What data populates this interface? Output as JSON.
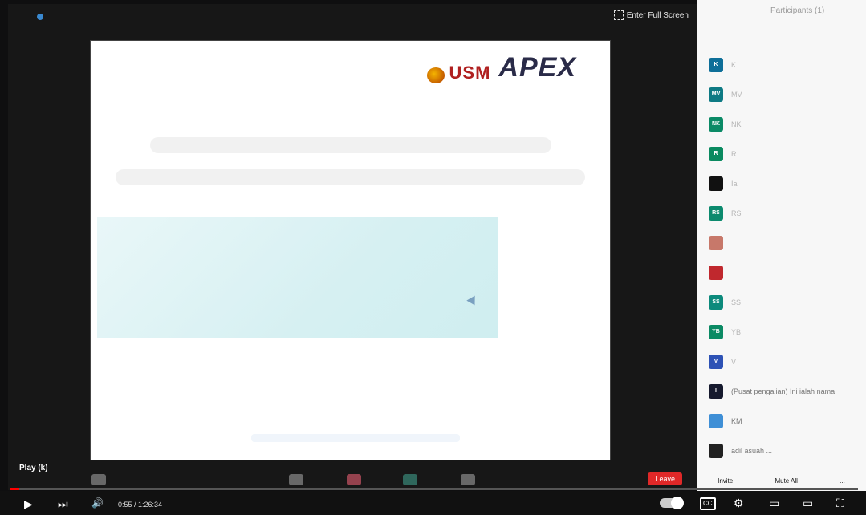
{
  "meeting": {
    "fullscreen_label": "Enter Full Screen",
    "slide": {
      "usm_logo_text": "USM",
      "apex_logo_text": "APEX"
    },
    "toolbar": {
      "leave_label": "Leave"
    }
  },
  "participants_panel": {
    "title": "Participants (1)",
    "participants": [
      {
        "initials": "K",
        "name": "K",
        "color": "#0e6f99"
      },
      {
        "initials": "MV",
        "name": "MV",
        "color": "#0e7a84"
      },
      {
        "initials": "NK",
        "name": "NK",
        "color": "#0b8a66"
      },
      {
        "initials": "R",
        "name": "R",
        "color": "#0a8a60"
      },
      {
        "initials": "",
        "name": "Ia",
        "color": "#111111"
      },
      {
        "initials": "RS",
        "name": "RS",
        "color": "#0c8a6e"
      },
      {
        "initials": "",
        "name": "",
        "color": "#c7786a"
      },
      {
        "initials": "",
        "name": "",
        "color": "#c0282e"
      },
      {
        "initials": "SS",
        "name": "SS",
        "color": "#0c8a7c"
      },
      {
        "initials": "YB",
        "name": "YB",
        "color": "#0b8a64"
      },
      {
        "initials": "V",
        "name": "V",
        "color": "#2d52b5"
      },
      {
        "initials": "I",
        "name": "(Pusat pengajian) Ini ialah nama",
        "color": "#161a2e"
      },
      {
        "initials": "",
        "name": "KM",
        "color": "#3f8fd6"
      },
      {
        "initials": "",
        "name": "adil asuah ...",
        "color": "#222222"
      }
    ],
    "buttons": {
      "invite": "Invite",
      "mute_all": "Mute All",
      "more": "..."
    }
  },
  "player": {
    "tooltip": "Play (k)",
    "play_icon": "▶",
    "next_icon": "⏭",
    "volume_icon": "🔊",
    "time": "0:55 / 1:26:34",
    "progress": 0.011,
    "cc_label": "CC",
    "settings_icon": "⚙",
    "miniplayer_icon": "▭",
    "theater_icon": "▭",
    "fullscreen_icon": "⛶"
  }
}
